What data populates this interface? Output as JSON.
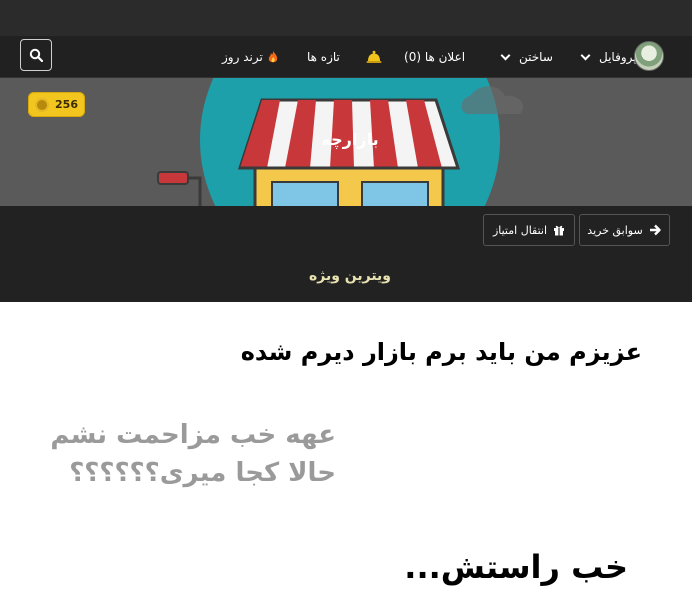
{
  "navbar": {
    "profile_label": "پروفایل",
    "build_label": "ساختن",
    "notifications_label": "اعلان ها (0)",
    "new_label": "تازه ها",
    "trending_label": "ترند روز"
  },
  "banner": {
    "title": "بازارچه",
    "coins": "256"
  },
  "actions": {
    "purchase_history": "سوابق خرید",
    "transfer_points": "انتقال امتیاز"
  },
  "section": {
    "title": "ویترین ویژه"
  },
  "captions": {
    "line1": "عزیزم من باید برم بازار دیرم شده",
    "line2": "عهه خب مزاحمت نشم",
    "line3": "حالا کجا میری؟؟؟؟؟؟",
    "line4": "خب راستش..."
  },
  "colors": {
    "navbar_bg": "#212121",
    "banner_bg": "#5a5a5a",
    "coin_badge": "#f3c61f",
    "awning_red": "#c8373a",
    "shop_yellow": "#f4c84a",
    "circle_teal": "#1ea0ab"
  }
}
